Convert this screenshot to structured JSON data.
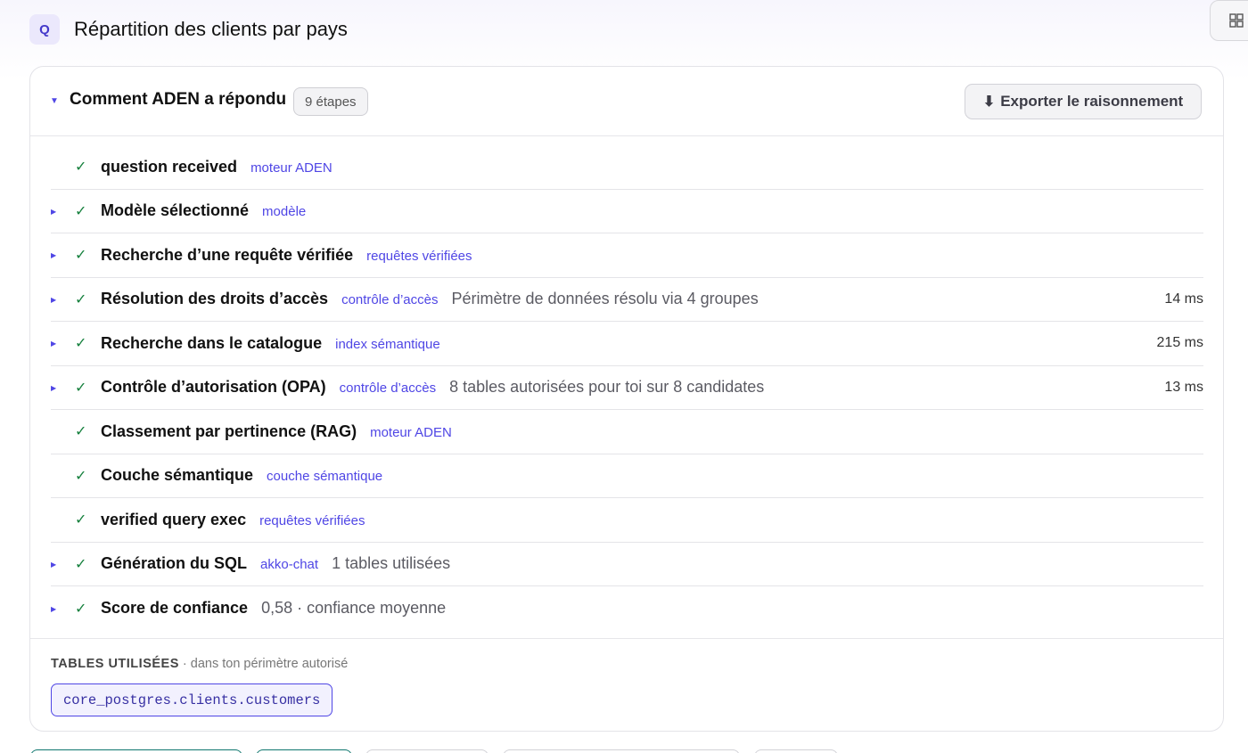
{
  "header": {
    "badge": "Q",
    "question": "Répartition des clients par pays"
  },
  "corner_icon": "grid-icon",
  "panel": {
    "toggle_icon": "triangle-down-icon",
    "title": "Comment ADEN a répondu",
    "steps_count": "9 étapes",
    "export_icon": "⬇",
    "export_label": "Exporter le raisonnement"
  },
  "steps": [
    {
      "expandable": false,
      "name": "question received",
      "tag": "moteur ADEN",
      "detail": "",
      "timing": ""
    },
    {
      "expandable": true,
      "name": "Modèle sélectionné",
      "tag": "modèle",
      "detail": "",
      "timing": ""
    },
    {
      "expandable": true,
      "name": "Recherche d’une requête vérifiée",
      "tag": "requêtes vérifiées",
      "detail": "",
      "timing": ""
    },
    {
      "expandable": true,
      "name": "Résolution des droits d’accès",
      "tag": "contrôle d’accès",
      "detail": "Périmètre de données résolu via 4 groupes",
      "timing": "14 ms"
    },
    {
      "expandable": true,
      "name": "Recherche dans le catalogue",
      "tag": "index sémantique",
      "detail": "",
      "timing": "215 ms"
    },
    {
      "expandable": true,
      "name": "Contrôle d’autorisation (OPA)",
      "tag": "contrôle d’accès",
      "detail": "8 tables autorisées pour toi sur 8 candidates",
      "timing": "13 ms"
    },
    {
      "expandable": false,
      "name": "Classement par pertinence (RAG)",
      "tag": "moteur ADEN",
      "detail": "",
      "timing": ""
    },
    {
      "expandable": false,
      "name": "Couche sémantique",
      "tag": "couche sémantique",
      "detail": "",
      "timing": ""
    },
    {
      "expandable": false,
      "name": "verified query exec",
      "tag": "requêtes vérifiées",
      "detail": "",
      "timing": ""
    },
    {
      "expandable": true,
      "name": "Génération du SQL",
      "tag": "akko-chat",
      "detail": "1 tables utilisées",
      "timing": ""
    },
    {
      "expandable": true,
      "name": "Score de confiance",
      "tag": "",
      "detail": "0,58 · confiance moyenne",
      "timing": ""
    }
  ],
  "tables_used": {
    "label": "TABLES UTILISÉES",
    "sublabel": " · dans ton périmètre autorisé",
    "tables": [
      "core_postgres.clients.customers"
    ]
  },
  "colors": {
    "accent": "#4f46e5",
    "check": "#15803d",
    "border": "#e3e3e8",
    "peek_green": "#0f766e",
    "peek_gray": "#d1d1d6"
  }
}
